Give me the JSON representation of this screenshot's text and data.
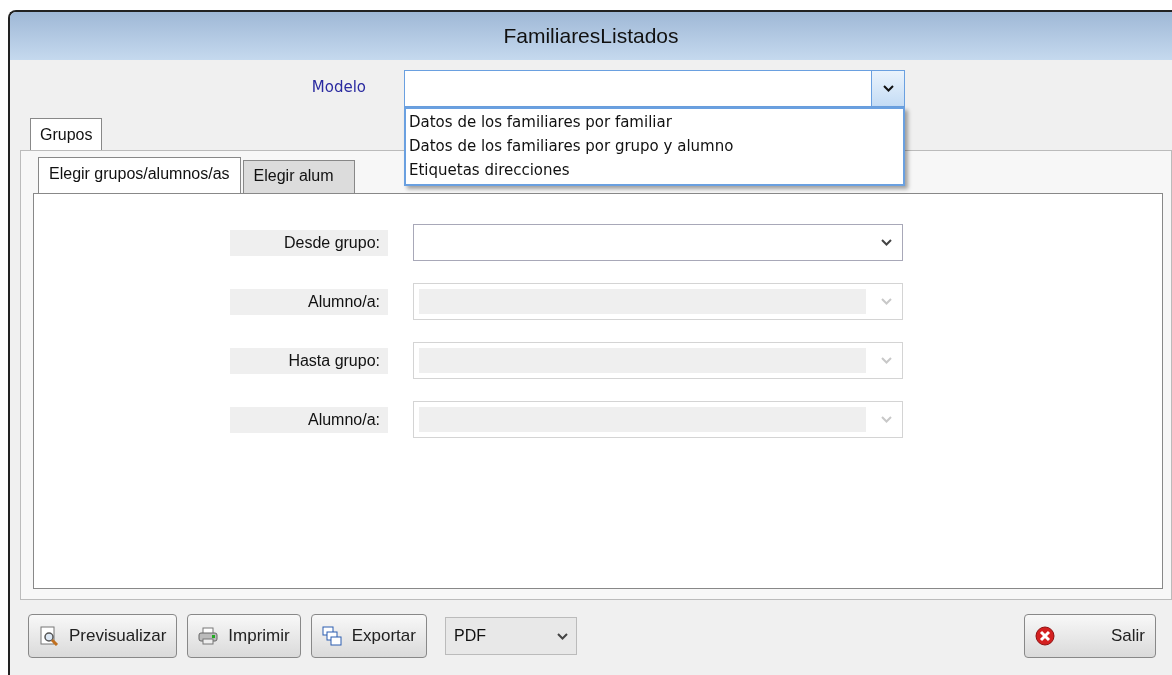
{
  "window": {
    "title": "FamiliaresListados"
  },
  "modelo": {
    "label": "Modelo",
    "expanded": true,
    "options": [
      {
        "label": "Datos de los familiares por familiar",
        "selected": false
      },
      {
        "label": "Datos de los familiares por grupo y alumno",
        "selected": false
      },
      {
        "label": "Etiquetas direcciones",
        "selected": false
      }
    ]
  },
  "outer_tabs": [
    {
      "label": "Grupos",
      "selected": true
    }
  ],
  "inner_tabs": [
    {
      "label": "Elegir grupos/alumnos/as",
      "selected": true
    },
    {
      "label": "Elegir alum",
      "selected": false
    }
  ],
  "fields": [
    {
      "label": "Desde grupo:",
      "disabled": false
    },
    {
      "label": "Alumno/a:",
      "disabled": true
    },
    {
      "label": "Hasta grupo:",
      "disabled": true
    },
    {
      "label": "Alumno/a:",
      "disabled": true
    }
  ],
  "toolbar": {
    "buttons": [
      {
        "label": "Previsualizar",
        "kind": "preview"
      },
      {
        "label": "Imprimir",
        "kind": "print"
      },
      {
        "label": "Exportar",
        "kind": "export"
      }
    ],
    "format": {
      "value": "PDF"
    }
  },
  "exit_button": {
    "label": "Salir",
    "kind": "exit"
  }
}
